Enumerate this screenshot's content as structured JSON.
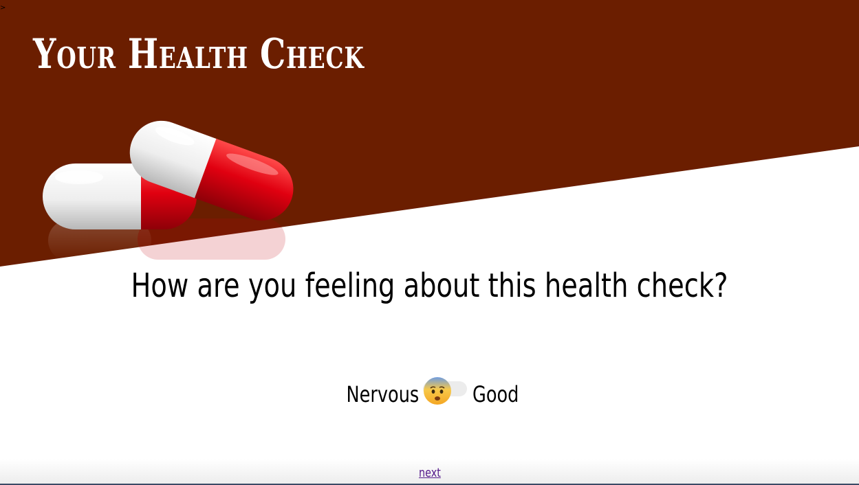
{
  "header": {
    "title": "Your Health Check",
    "background_color": "#6b1e00"
  },
  "question": {
    "text": "How are you feeling about this health check?"
  },
  "mood_slider": {
    "left_label": "Nervous",
    "right_label": "Good",
    "current_icon": "fearful-face-emoji",
    "value": 0
  },
  "footer": {
    "next_label": "next"
  },
  "colors": {
    "header": "#6b1e00",
    "pill_red": "#e00010",
    "pill_white": "#f4f4f4",
    "link": "#551a8b"
  }
}
